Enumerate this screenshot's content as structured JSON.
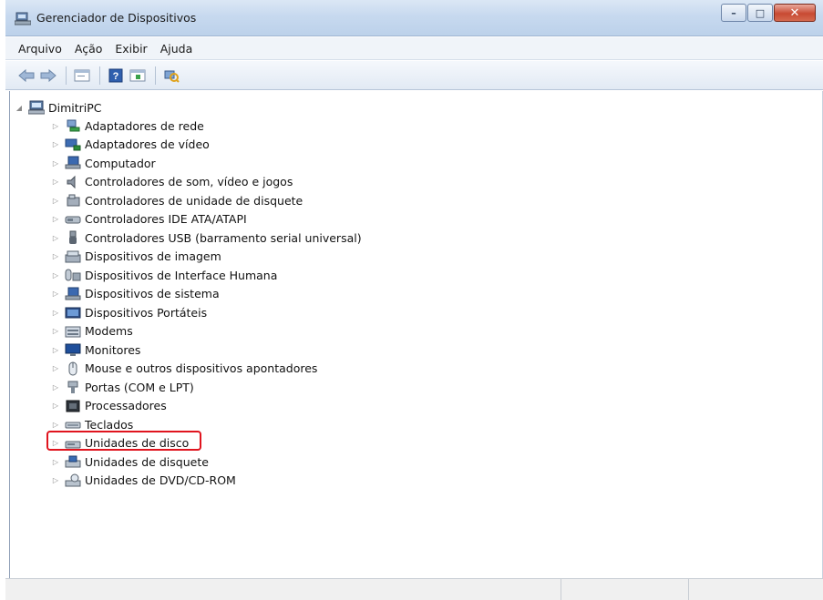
{
  "window": {
    "title": "Gerenciador de Dispositivos",
    "accent": "#bcd1ea",
    "close_color": "#c84a33"
  },
  "window_controls": {
    "minimize_icon": "minimize-icon",
    "maximize_icon": "maximize-icon",
    "close_icon": "close-icon"
  },
  "menu": {
    "items": [
      {
        "label": "Arquivo"
      },
      {
        "label": "Ação"
      },
      {
        "label": "Exibir"
      },
      {
        "label": "Ajuda"
      }
    ]
  },
  "toolbar": {
    "buttons": [
      {
        "icon": "back-arrow-icon"
      },
      {
        "icon": "forward-arrow-icon"
      },
      {
        "icon": "properties-icon"
      },
      {
        "icon": "help-icon"
      },
      {
        "icon": "console-view-icon"
      },
      {
        "icon": "scan-hardware-icon"
      }
    ]
  },
  "tree": {
    "root": {
      "label": "DimitriPC",
      "icon": "computer-icon"
    },
    "items": [
      {
        "label": "Adaptadores de rede",
        "icon": "network-adapter-icon"
      },
      {
        "label": "Adaptadores de vídeo",
        "icon": "display-adapter-icon"
      },
      {
        "label": "Computador",
        "icon": "computer-monitor-icon"
      },
      {
        "label": "Controladores de som, vídeo e jogos",
        "icon": "speaker-icon"
      },
      {
        "label": "Controladores de unidade de disquete",
        "icon": "floppy-controller-icon"
      },
      {
        "label": "Controladores IDE ATA/ATAPI",
        "icon": "ide-controller-icon"
      },
      {
        "label": "Controladores USB (barramento serial universal)",
        "icon": "usb-icon"
      },
      {
        "label": "Dispositivos de imagem",
        "icon": "scanner-icon"
      },
      {
        "label": "Dispositivos de Interface Humana",
        "icon": "hid-icon"
      },
      {
        "label": "Dispositivos de sistema",
        "icon": "system-device-icon"
      },
      {
        "label": "Dispositivos Portáteis",
        "icon": "portable-device-icon"
      },
      {
        "label": "Modems",
        "icon": "modem-icon"
      },
      {
        "label": "Monitores",
        "icon": "monitor-icon"
      },
      {
        "label": "Mouse e outros dispositivos apontadores",
        "icon": "mouse-icon"
      },
      {
        "label": "Portas (COM e LPT)",
        "icon": "port-icon"
      },
      {
        "label": "Processadores",
        "icon": "processor-icon"
      },
      {
        "label": "Teclados",
        "icon": "keyboard-icon"
      },
      {
        "label": "Unidades de disco",
        "icon": "disk-drive-icon",
        "highlighted": true
      },
      {
        "label": "Unidades de disquete",
        "icon": "floppy-drive-icon"
      },
      {
        "label": "Unidades de DVD/CD-ROM",
        "icon": "dvd-drive-icon"
      }
    ]
  },
  "highlight_color": "#e0141e"
}
